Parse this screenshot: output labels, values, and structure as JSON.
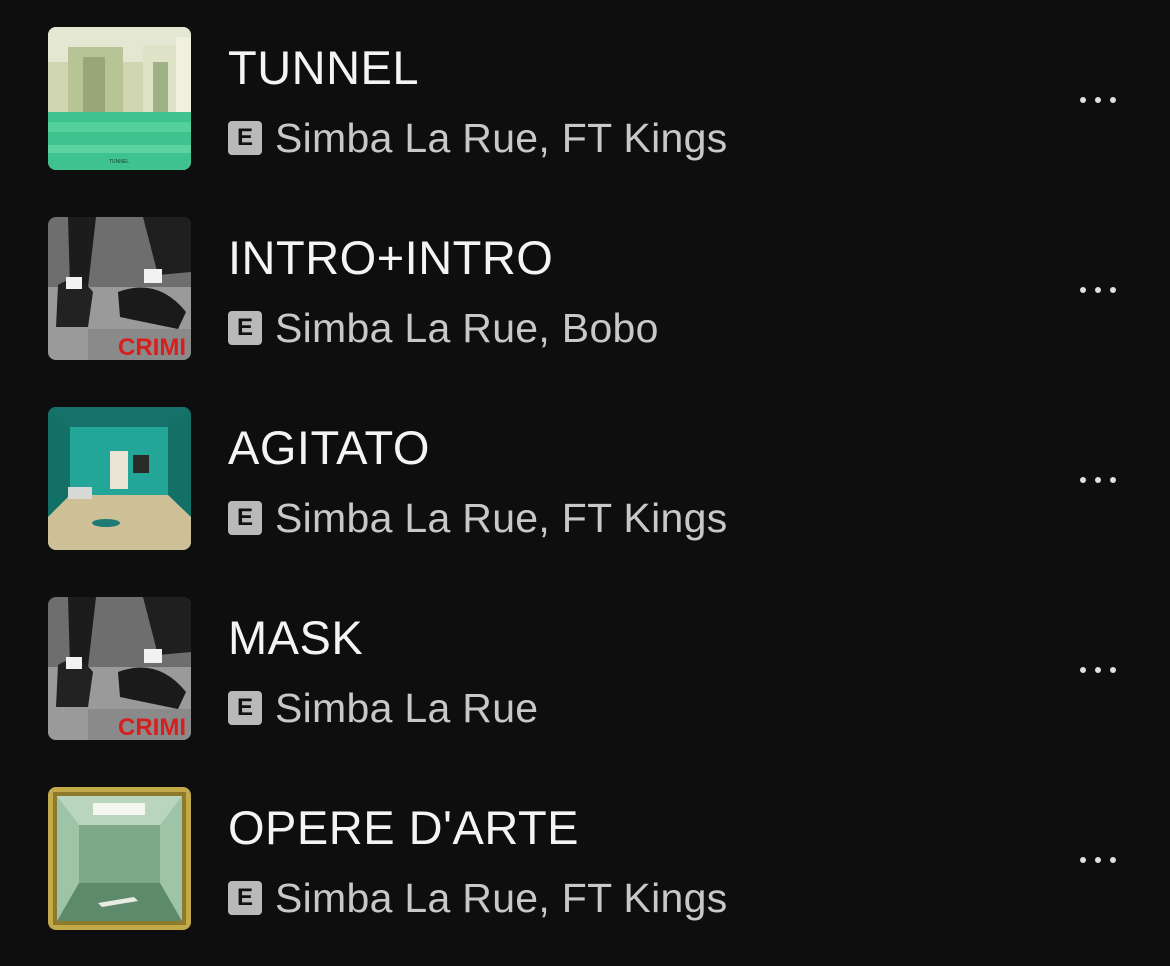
{
  "tracks": [
    {
      "title": "TUNNEL",
      "artists": "Simba La Rue, FT Kings",
      "explicit": "E",
      "cover": "tunnel-cover",
      "cover_label": "TUNNEL"
    },
    {
      "title": "INTRO+INTRO",
      "artists": "Simba La Rue, Bobo",
      "explicit": "E",
      "cover": "crimi-cover",
      "cover_label": "CRIMI"
    },
    {
      "title": "AGITATO",
      "artists": "Simba La Rue, FT Kings",
      "explicit": "E",
      "cover": "teal-room-cover"
    },
    {
      "title": "MASK",
      "artists": "Simba La Rue",
      "explicit": "E",
      "cover": "crimi-cover",
      "cover_label": "CRIMI"
    },
    {
      "title": "OPERE D'ARTE",
      "artists": "Simba La Rue, FT Kings",
      "explicit": "E",
      "cover": "framed-room-cover"
    }
  ],
  "icons": {
    "more": "more-options-icon",
    "explicit": "explicit-badge"
  },
  "colors": {
    "background": "#0e0e0e",
    "title": "#f4f4f4",
    "subtitle": "#c8c8c8",
    "badge": "#b9b9b9"
  }
}
